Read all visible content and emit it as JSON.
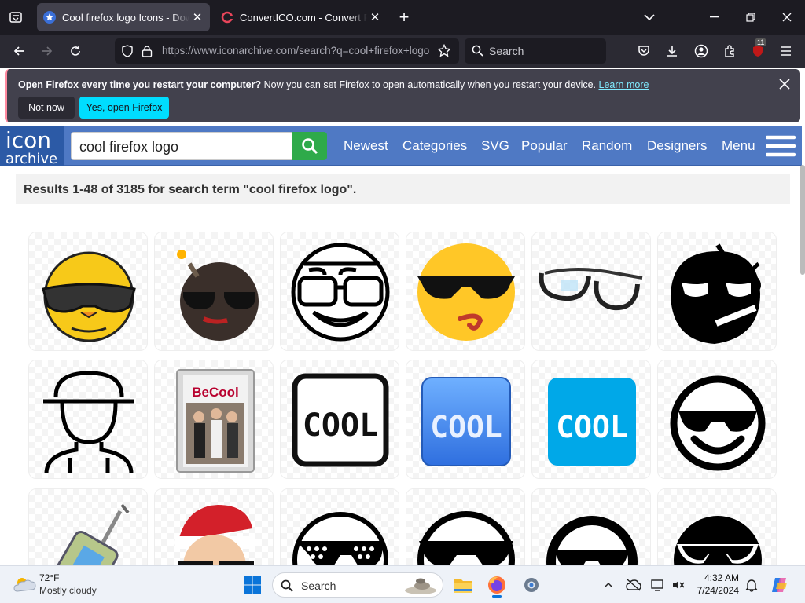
{
  "browser": {
    "tabs": [
      {
        "title": "Cool firefox logo Icons - Download",
        "active": true,
        "favicon": "star-icon"
      },
      {
        "title": "ConvertICO.com - Convert PNG",
        "active": false,
        "favicon": "converticoicon"
      }
    ],
    "url": "https://www.iconarchive.com/search?q=cool+firefox+logo",
    "search_placeholder": "Search",
    "extension_badge": "11"
  },
  "notification": {
    "bold": "Open Firefox every time you restart your computer?",
    "text": " Now you can set Firefox to open automatically when you restart your device. ",
    "link": "Learn more",
    "btn_not_now": "Not now",
    "btn_yes": "Yes, open Firefox"
  },
  "site": {
    "logo_top": "icon",
    "logo_bottom": "archive",
    "search_value": "cool firefox logo",
    "nav": [
      "Newest",
      "Categories",
      "SVG",
      "Popular",
      "Random",
      "Designers",
      "Menu"
    ],
    "results": "Results 1-48 of 3185 for search term \"cool firefox logo\".",
    "cool_labels": [
      "COOL",
      "COOL",
      "COOL"
    ],
    "dvd_title": "BeCool",
    "colors": {
      "header": "#4f79c4",
      "search_button": "#2eaa4a",
      "cool_blue": "#00a8e8"
    }
  },
  "taskbar": {
    "weather_temp": "72°F",
    "weather_desc": "Mostly cloudy",
    "search_label": "Search",
    "time": "4:32 AM",
    "date": "7/24/2024"
  }
}
